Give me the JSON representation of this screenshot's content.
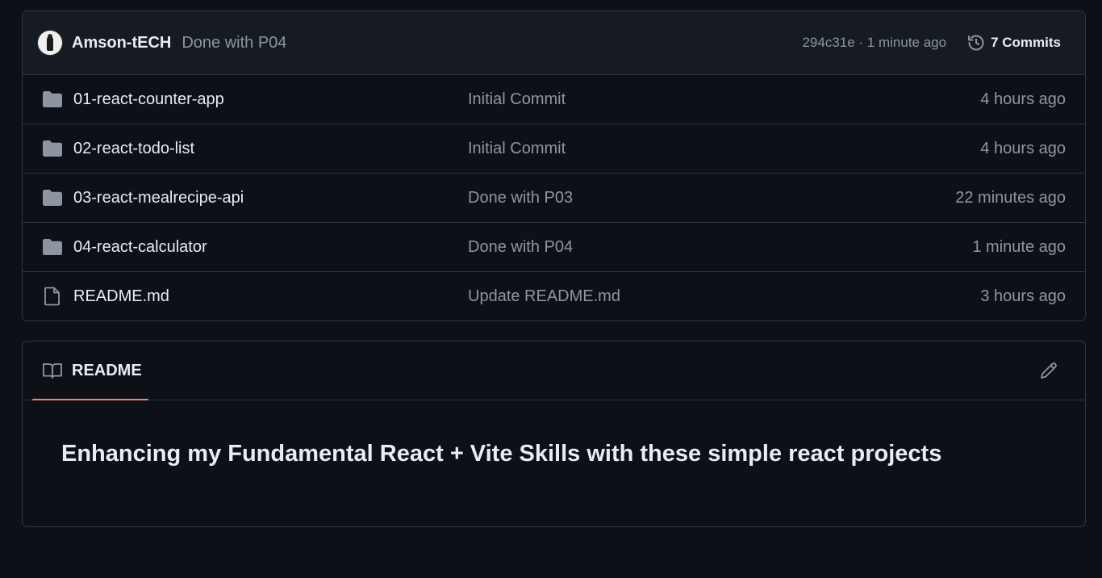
{
  "commit": {
    "author": "Amson-tECH",
    "message": "Done with P04",
    "meta": "294c31e · 1 minute ago",
    "commits_label": "7 Commits"
  },
  "files": [
    {
      "name": "01-react-counter-app",
      "type": "folder",
      "commit": "Initial Commit",
      "time": "4 hours ago"
    },
    {
      "name": "02-react-todo-list",
      "type": "folder",
      "commit": "Initial Commit",
      "time": "4 hours ago"
    },
    {
      "name": "03-react-mealrecipe-api",
      "type": "folder",
      "commit": "Done with P03",
      "time": "22 minutes ago"
    },
    {
      "name": "04-react-calculator",
      "type": "folder",
      "commit": "Done with P04",
      "time": "1 minute ago"
    },
    {
      "name": "README.md",
      "type": "file",
      "commit": "Update README.md",
      "time": "3 hours ago"
    }
  ],
  "readme": {
    "tab_label": "README",
    "heading": "Enhancing my Fundamental React + Vite Skills with these simple react projects"
  },
  "colors": {
    "background": "#0d1117",
    "header_bg": "#161b22",
    "border": "#30363d",
    "text": "#e6edf3",
    "muted": "#8d96a0",
    "folder_icon": "#8d96a0",
    "tab_accent": "#f78166"
  }
}
